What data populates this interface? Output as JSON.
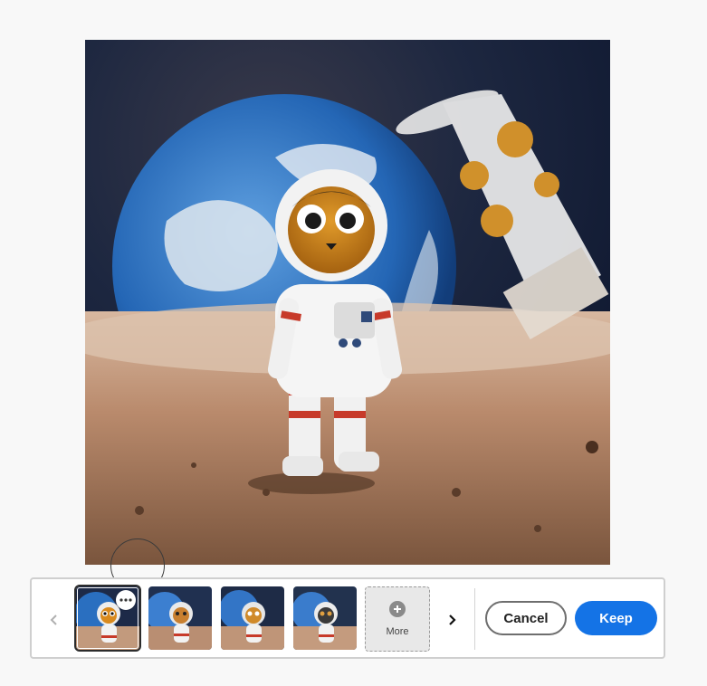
{
  "canvas": {
    "image_subject": "toy-astronaut-on-moon"
  },
  "variations": {
    "thumbnails": [
      {
        "id": "variation-1",
        "selected": true
      },
      {
        "id": "variation-2",
        "selected": false
      },
      {
        "id": "variation-3",
        "selected": false
      },
      {
        "id": "variation-4",
        "selected": false
      }
    ],
    "more_label": "More",
    "prev_icon": "chevron-left-icon",
    "next_icon": "chevron-right-icon",
    "menu_icon": "more-options-icon"
  },
  "actions": {
    "cancel_label": "Cancel",
    "keep_label": "Keep"
  },
  "colors": {
    "accent": "#1473e6",
    "page_background": "#f8f8f8"
  }
}
